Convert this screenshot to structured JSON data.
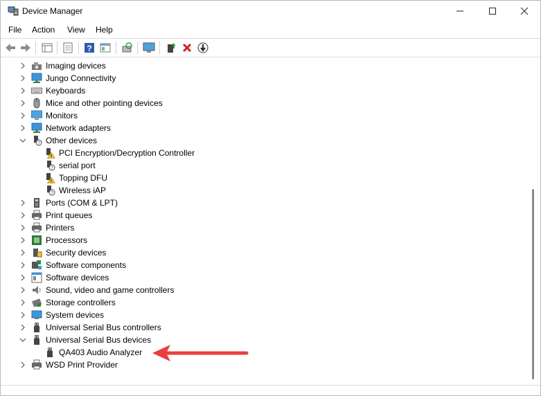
{
  "window": {
    "title": "Device Manager"
  },
  "menu": [
    "File",
    "Action",
    "View",
    "Help"
  ],
  "toolbar_icons": [
    "back-icon",
    "forward-icon",
    "properties-grid-icon",
    "properties-icon",
    "help-icon",
    "view-icon",
    "scan-hardware-icon",
    "monitor-icon",
    "update-driver-icon",
    "uninstall-icon",
    "disable-icon"
  ],
  "tree": [
    {
      "label": "Imaging devices",
      "level": 0,
      "expander": "collapsed",
      "icon": "camera-icon"
    },
    {
      "label": "Jungo Connectivity",
      "level": 0,
      "expander": "collapsed",
      "icon": "network-adapter-icon"
    },
    {
      "label": "Keyboards",
      "level": 0,
      "expander": "collapsed",
      "icon": "keyboard-icon"
    },
    {
      "label": "Mice and other pointing devices",
      "level": 0,
      "expander": "collapsed",
      "icon": "mouse-icon"
    },
    {
      "label": "Monitors",
      "level": 0,
      "expander": "collapsed",
      "icon": "monitor-icon"
    },
    {
      "label": "Network adapters",
      "level": 0,
      "expander": "collapsed",
      "icon": "network-adapter-icon"
    },
    {
      "label": "Other devices",
      "level": 0,
      "expander": "expanded",
      "icon": "unknown-device-icon"
    },
    {
      "label": "PCI Encryption/Decryption Controller",
      "level": 1,
      "expander": "none",
      "icon": "warning-device-icon"
    },
    {
      "label": "serial port",
      "level": 1,
      "expander": "none",
      "icon": "unknown-device-icon"
    },
    {
      "label": "Topping DFU",
      "level": 1,
      "expander": "none",
      "icon": "warning-device-icon"
    },
    {
      "label": "Wireless iAP",
      "level": 1,
      "expander": "none",
      "icon": "unknown-device-icon"
    },
    {
      "label": "Ports (COM & LPT)",
      "level": 0,
      "expander": "collapsed",
      "icon": "port-icon"
    },
    {
      "label": "Print queues",
      "level": 0,
      "expander": "collapsed",
      "icon": "printer-icon"
    },
    {
      "label": "Printers",
      "level": 0,
      "expander": "collapsed",
      "icon": "printer-icon"
    },
    {
      "label": "Processors",
      "level": 0,
      "expander": "collapsed",
      "icon": "processor-icon"
    },
    {
      "label": "Security devices",
      "level": 0,
      "expander": "collapsed",
      "icon": "security-device-icon"
    },
    {
      "label": "Software components",
      "level": 0,
      "expander": "collapsed",
      "icon": "software-component-icon"
    },
    {
      "label": "Software devices",
      "level": 0,
      "expander": "collapsed",
      "icon": "software-device-icon"
    },
    {
      "label": "Sound, video and game controllers",
      "level": 0,
      "expander": "collapsed",
      "icon": "speaker-icon"
    },
    {
      "label": "Storage controllers",
      "level": 0,
      "expander": "collapsed",
      "icon": "storage-controller-icon"
    },
    {
      "label": "System devices",
      "level": 0,
      "expander": "collapsed",
      "icon": "system-device-icon"
    },
    {
      "label": "Universal Serial Bus controllers",
      "level": 0,
      "expander": "collapsed",
      "icon": "usb-icon"
    },
    {
      "label": "Universal Serial Bus devices",
      "level": 0,
      "expander": "expanded",
      "icon": "usb-icon"
    },
    {
      "label": "QA403 Audio Analyzer",
      "level": 1,
      "expander": "none",
      "icon": "usb-icon"
    },
    {
      "label": "WSD Print Provider",
      "level": 0,
      "expander": "collapsed",
      "icon": "printer-icon"
    }
  ],
  "colors": {
    "annotation_arrow": "#e8413c",
    "accent": "#1e88e5"
  }
}
